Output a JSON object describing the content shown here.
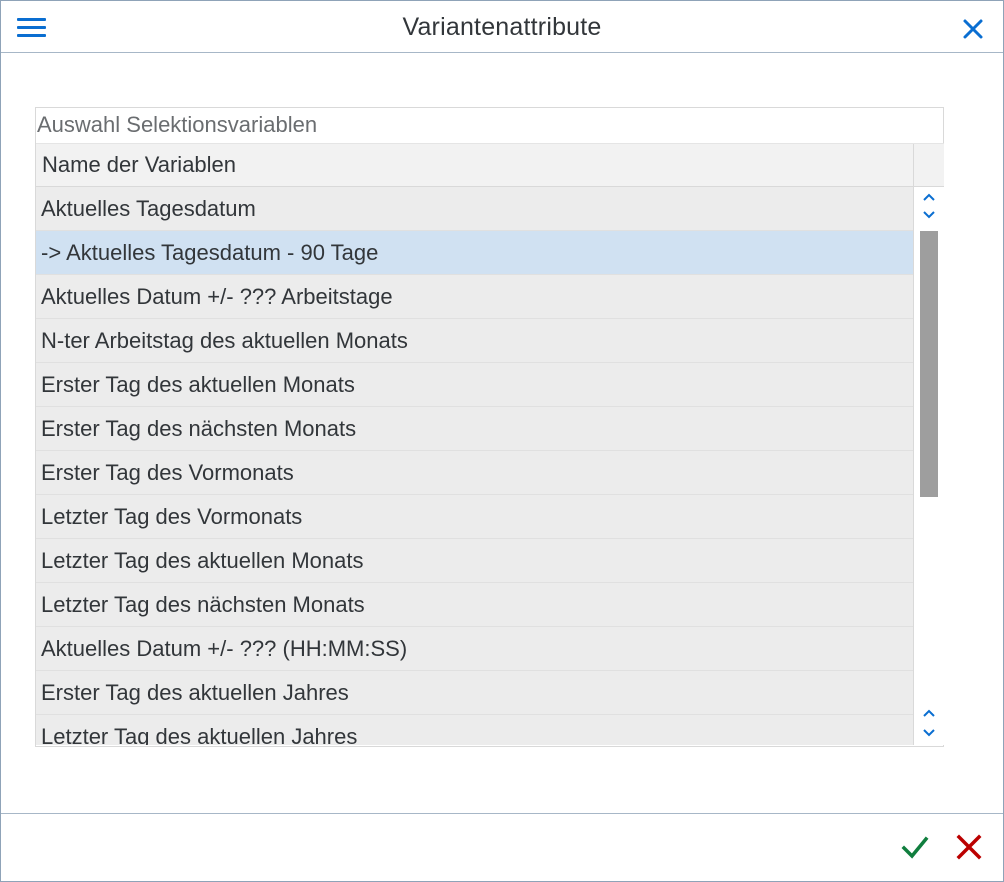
{
  "header": {
    "title": "Variantenattribute",
    "menu_icon": "hamburger-menu-icon",
    "close_icon": "close-icon"
  },
  "panel": {
    "title": "Auswahl Selektionsvariablen",
    "column_header": "Name der Variablen",
    "rows": [
      {
        "label": "Aktuelles Tagesdatum",
        "selected": false
      },
      {
        "label": "-> Aktuelles Tagesdatum - 90 Tage",
        "selected": true
      },
      {
        "label": "Aktuelles Datum +/- ??? Arbeitstage",
        "selected": false
      },
      {
        "label": "N-ter Arbeitstag des aktuellen Monats",
        "selected": false
      },
      {
        "label": "Erster Tag des aktuellen Monats",
        "selected": false
      },
      {
        "label": "Erster Tag des nächsten Monats",
        "selected": false
      },
      {
        "label": "Erster Tag des Vormonats",
        "selected": false
      },
      {
        "label": "Letzter Tag des Vormonats",
        "selected": false
      },
      {
        "label": "Letzter Tag des aktuellen Monats",
        "selected": false
      },
      {
        "label": "Letzter Tag des nächsten Monats",
        "selected": false
      },
      {
        "label": "Aktuelles Datum +/- ??? (HH:MM:SS)",
        "selected": false
      },
      {
        "label": "Erster Tag des aktuellen Jahres",
        "selected": false
      },
      {
        "label": "Letzter Tag des aktuellen Jahres",
        "selected": false
      }
    ]
  },
  "footer": {
    "ok_icon": "checkmark-icon",
    "cancel_icon": "cancel-icon"
  },
  "colors": {
    "accent": "#0a6ed1",
    "selected_row": "#d0e1f2",
    "row_bg": "#ececec",
    "ok_green": "#107e3e",
    "cancel_red": "#bb0000"
  }
}
